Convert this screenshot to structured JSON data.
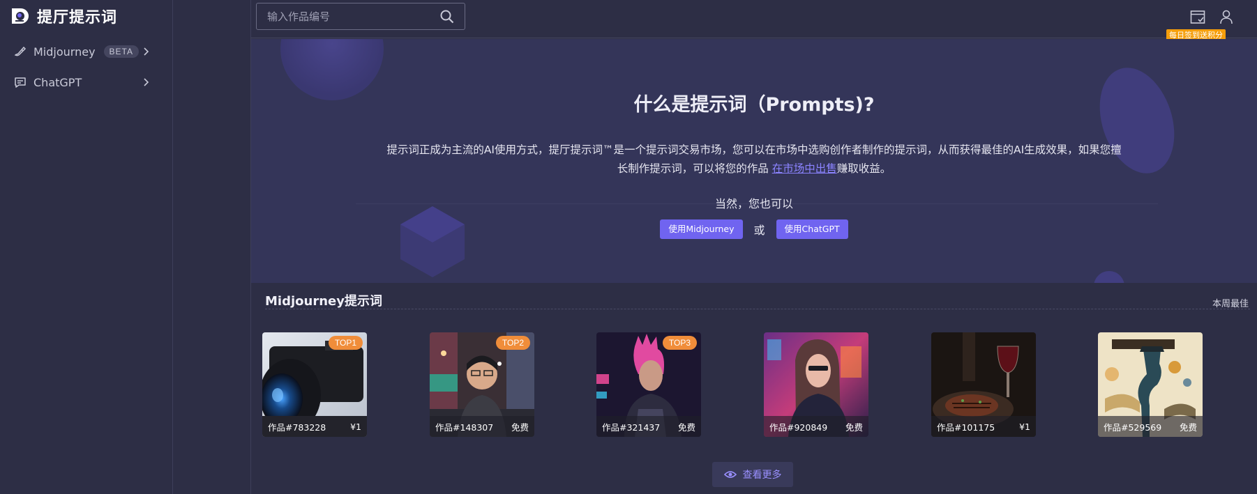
{
  "app": {
    "title": "提厅提示词"
  },
  "sidebar": {
    "items": [
      {
        "label": "Midjourney",
        "badge": "BETA",
        "icon": "brush-icon"
      },
      {
        "label": "ChatGPT",
        "icon": "chat-icon"
      }
    ]
  },
  "header": {
    "search_placeholder": "输入作品编号",
    "signin_badge": "每日签到送积分",
    "icons": [
      "calendar-check-icon",
      "user-icon"
    ]
  },
  "hero": {
    "title": "什么是提示词（Prompts)?",
    "desc_before": "提示词正成为主流的AI使用方式，提厅提示词™是一个提示词交易市场，您可以在市场中选购创作者制作的提示词，从而获得最佳的AI生成效果，如果您擅长制作提示词，可以将您的作品 ",
    "desc_link": "在市场中出售",
    "desc_after": "赚取收益。",
    "also": "当然，您也可以",
    "btn_midjourney": "使用Midjourney",
    "or": "或",
    "btn_chatgpt": "使用ChatGPT"
  },
  "section": {
    "title": "Midjourney提示词",
    "week_best": "本周最佳",
    "more": "查看更多"
  },
  "cards": [
    {
      "badge": "TOP1",
      "id": "作品#783228",
      "price": "¥1",
      "theme": "camera"
    },
    {
      "badge": "TOP2",
      "id": "作品#148307",
      "price": "免费",
      "theme": "street-portrait"
    },
    {
      "badge": "TOP3",
      "id": "作品#321437",
      "price": "免费",
      "theme": "cyberpunk-pink-hair"
    },
    {
      "badge": "",
      "id": "作品#920849",
      "price": "免费",
      "theme": "neon-woman"
    },
    {
      "badge": "",
      "id": "作品#101175",
      "price": "¥1",
      "theme": "steak-wine"
    },
    {
      "badge": "",
      "id": "作品#529569",
      "price": "免费",
      "theme": "vintage-infographic"
    }
  ],
  "colors": {
    "bg": "#2d2e45",
    "hero_bg": "#343559",
    "accent": "#7064f0",
    "top_badge": "#f08d3a",
    "signin": "#f59e0b"
  }
}
